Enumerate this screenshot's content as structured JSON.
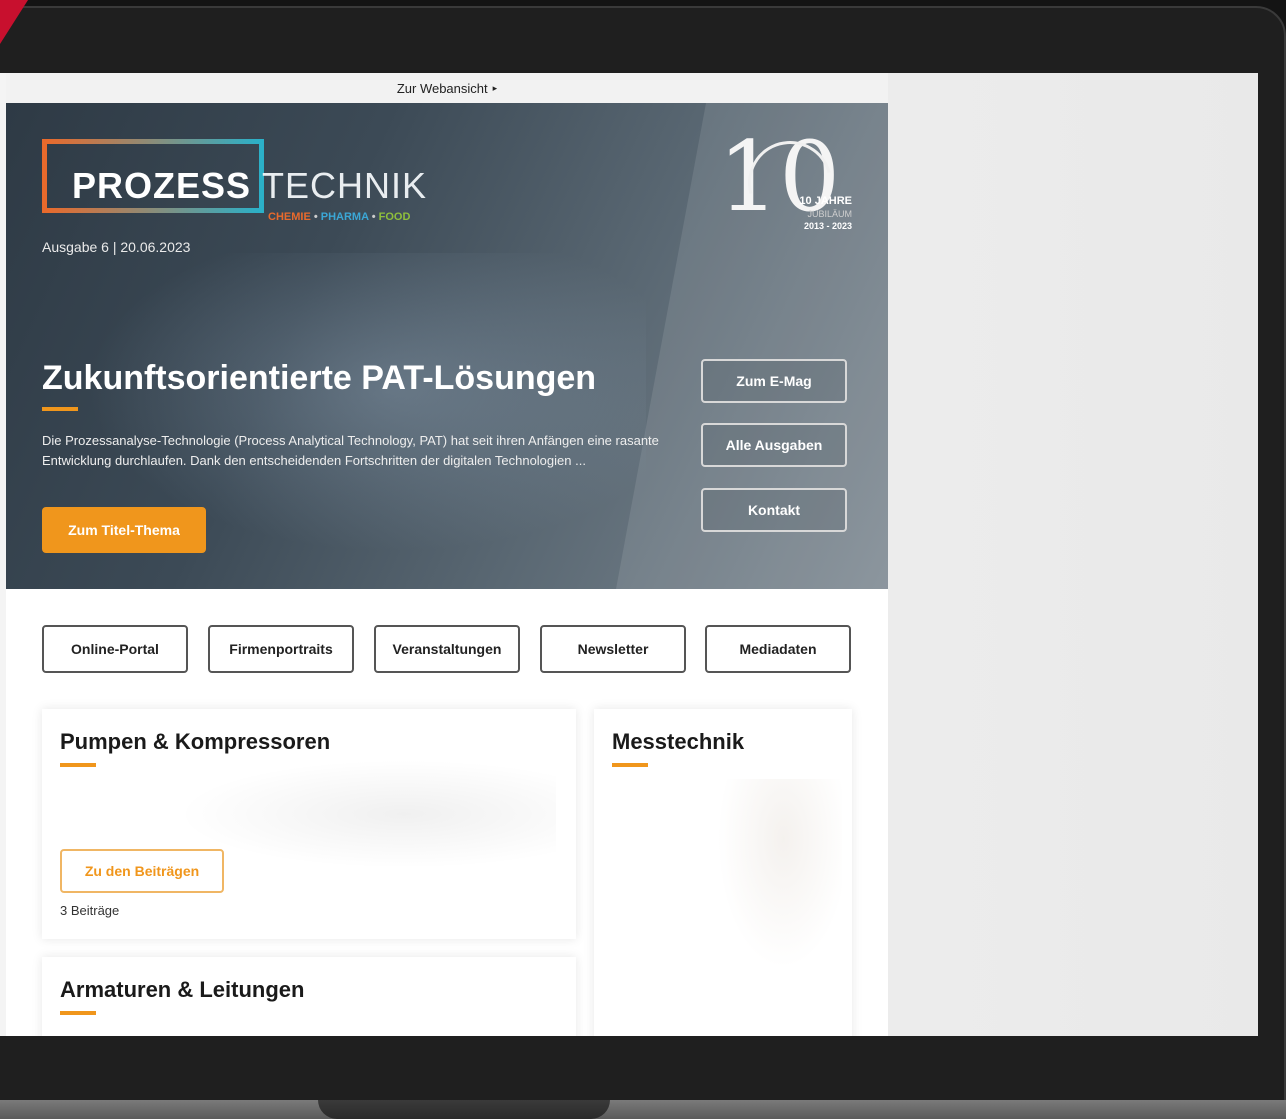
{
  "topbar": {
    "web_view_link": "Zur Webansicht",
    "arrow_glyph": "▸"
  },
  "logo": {
    "prozess": "PROZESS",
    "technik": "TECHNIK",
    "sub_chemie": "CHEMIE",
    "sub_pharma": "PHARMA",
    "sub_food": "FOOD",
    "sep": "•"
  },
  "issue": "Ausgabe 6 | 20.06.2023",
  "anniversary": {
    "numeral": "10",
    "line1": "10 JAHRE",
    "line2": "JUBILÄUM",
    "line3": "2013 - 2023"
  },
  "hero": {
    "headline": "Zukunftsorientierte PAT-Lösungen",
    "lead": "Die Prozessanalyse-Technologie (Process Analytical Technology, PAT) hat seit ihren Anfängen eine rasante Entwicklung durchlaufen. Dank den entscheidenden Fortschritten der digitalen Technologien ...",
    "cta": "Zum Titel-Thema"
  },
  "side_buttons": [
    "Zum E-Mag",
    "Alle Ausgaben",
    "Kontakt"
  ],
  "nav": [
    "Online-Portal",
    "Firmenportraits",
    "Veranstaltungen",
    "Newsletter",
    "Mediadaten"
  ],
  "cards": {
    "pumps": {
      "title": "Pumpen & Kompressoren",
      "button": "Zu den Beiträgen",
      "count": "3 Beiträge"
    },
    "messtechnik": {
      "title": "Messtechnik"
    },
    "armaturen": {
      "title": "Armaturen & Leitungen"
    }
  },
  "colors": {
    "accent": "#f0961c",
    "brand_red": "#c8102e"
  }
}
